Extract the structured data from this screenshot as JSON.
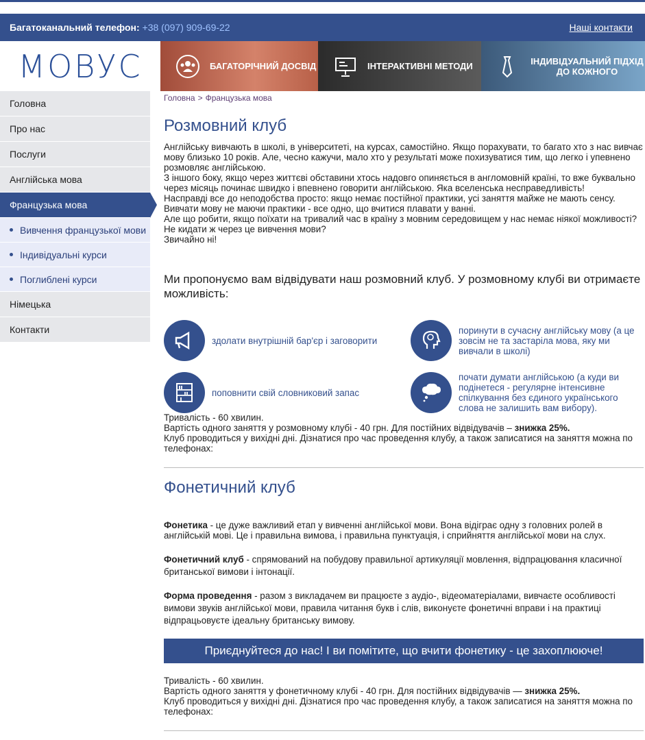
{
  "topbar": {
    "phone_label": "Багатоканальний телефон:",
    "phone": "+38 (097) 909-69-22",
    "contacts_link": "Наші контакти"
  },
  "logo": {
    "text": "МОВУС"
  },
  "banners": [
    {
      "label": "Багаторічний досвід",
      "icon": "people-icon"
    },
    {
      "label": "Інтерактивні методи",
      "icon": "presentation-icon"
    },
    {
      "label": "Індивідуальний підхід до кожного",
      "icon": "tie-icon"
    }
  ],
  "sidebar": {
    "items": [
      {
        "label": "Головна"
      },
      {
        "label": "Про нас"
      },
      {
        "label": "Послуги"
      },
      {
        "label": "Англійська мова"
      },
      {
        "label": "Французька мова"
      }
    ],
    "subitems": [
      {
        "label": "Вивчення французької мови"
      },
      {
        "label": "Індивідуальні курси"
      },
      {
        "label": "Поглиблені курси"
      }
    ],
    "items_after": [
      {
        "label": "Німецька"
      },
      {
        "label": "Контакти"
      }
    ]
  },
  "breadcrumb": {
    "home": "Головна",
    "sep": ">",
    "current": "Французька мова"
  },
  "club1": {
    "title": "Розмовний клуб",
    "paragraphs": [
      "Англійську вивчають в школі, в університеті, на курсах, самостійно. Якщо порахувати, то багато хто з нас вивчає мову близько 10 років. Але, чесно кажучи, мало хто у результаті може похизуватися тим, що легко і упевнено розмовляє англійською.",
      "З іншого боку, якщо через життєві обставини хтось надовго опиняється в англомовній країні, то вже буквально через місяць починає швидко і впевнено говорити англійською. Яка вселенська несправедливість!",
      "Насправді все до неподобства просто: якщо немає постійної практики, усі заняття майже не мають сенсу.",
      "Вивчати мову не маючи практики - все одно, що вчитися плавати у ванні.",
      "Але що робити, якщо поїхати на тривалий час в країну з мовним середовищем у нас немає ніякої можливості?",
      "Не кидати ж через це вивчення мови?",
      "Звичайно ні!"
    ],
    "lead": "Ми пропонуємо вам відвідувати наш розмовний клуб. У розмовному клубі ви отримаєте можливість:",
    "features": [
      {
        "icon": "megaphone-icon",
        "text": "здолати внутрішній бар'єр і заговорити"
      },
      {
        "icon": "brain-head-icon",
        "text": "поринути в сучасну англійську мову (а це зовсім не та застаріла мова, яку ми вивчали в школі)"
      },
      {
        "icon": "bookshelf-icon",
        "text": "поповнити свій словниковий запас"
      },
      {
        "icon": "thought-bubble-icon",
        "text": "почати думати англійською (а куди ви подінетеся - регулярне інтенсивне спілкування без єдиного українського слова не залишить вам вибору)."
      }
    ],
    "duration": "Тривалість - 60 хвилин.",
    "price_text": "Вартість одного заняття у розмовному клубі - 40 грн. Для постійних відвідувачів –",
    "discount": "знижка 25%.",
    "schedule": "Клуб проводиться у вихідні дні. Дізнатися про час проведення клубу, а також записатися на заняття можна по телефонах:"
  },
  "club2": {
    "title": "Фонетичний клуб",
    "p1_bold": "Фонетика",
    "p1": " - це дуже важливий етап у вивченні англійської мови. Вона відіграє одну з головних ролей в англійській мові. Це і правильна вимова, і правильна пунктуація, і сприйняття англійської мови на слух.",
    "p2_bold": "Фонетичний клуб",
    "p2": " - спрямований на побудову правильної артикуляції мовлення, відпрацювання класичної британської вимови і інтонації.",
    "p3_bold": "Форма проведення",
    "p3": " - разом з викладачем ви працюєте з аудіо-, відеоматеріалами, вивчаєте особливості вимови звуків англійської мови, правила читання букв і слів, виконуєте фонетичні вправи і на практиці відпрацьовуєте ідеальну британську вимову.",
    "cta": "Приєднуйтеся до нас! І ви помітите, що вчити фонетику - це захоплююче!",
    "duration": "Тривалість - 60 хвилин.",
    "price_text": "Вартість одного заняття у фонетичному клубі - 40 грн. Для постійних відвідувачів —",
    "discount": "знижка 25%.",
    "schedule": "Клуб проводиться у вихідні дні. Дізнатися про час проведення клубу, а також записатися на заняття можна по телефонах:"
  },
  "colors": {
    "brand": "#34508d",
    "sidebar_bg": "#e6e7ea",
    "submenu_bg": "#e8ebf8"
  }
}
